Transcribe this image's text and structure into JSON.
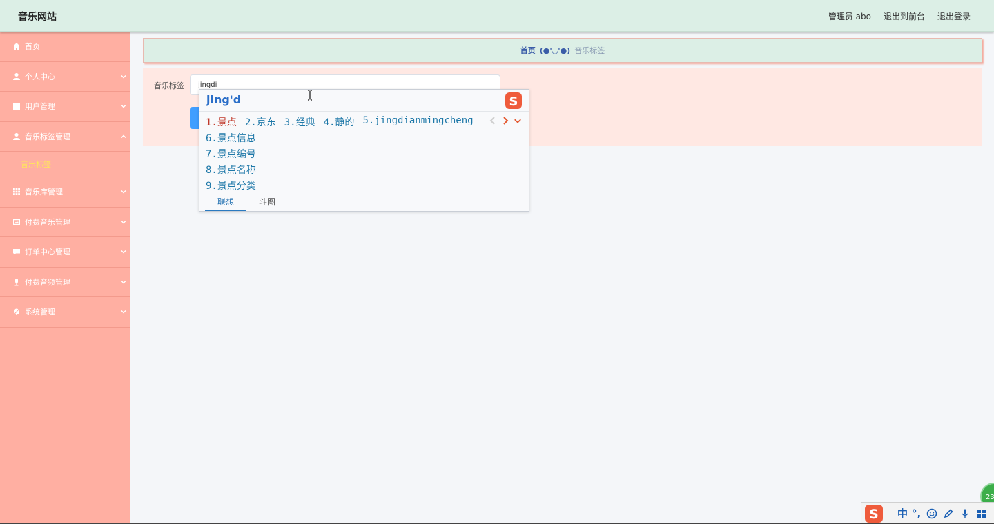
{
  "header": {
    "site_title": "音乐网站",
    "admin_label": "管理员 abo",
    "to_frontend": "退出到前台",
    "logout": "退出登录"
  },
  "sidebar": {
    "items": [
      {
        "label": "首页",
        "icon": "home-icon",
        "chevron": false
      },
      {
        "label": "个人中心",
        "icon": "user-icon",
        "chevron": true
      },
      {
        "label": "用户管理",
        "icon": "chart-icon",
        "chevron": true
      },
      {
        "label": "音乐标签管理",
        "icon": "user-icon",
        "chevron": "up"
      },
      {
        "label": "音乐库管理",
        "icon": "grid-icon",
        "chevron": true
      },
      {
        "label": "付费音乐管理",
        "icon": "image-icon",
        "chevron": true
      },
      {
        "label": "订单中心管理",
        "icon": "comment-icon",
        "chevron": true
      },
      {
        "label": "付费音频管理",
        "icon": "microphone-icon",
        "chevron": true
      },
      {
        "label": "系统管理",
        "icon": "bell-slash-icon",
        "chevron": true
      }
    ],
    "active_sub": "音乐标签"
  },
  "breadcrumb": {
    "home": "首页",
    "face": "(●'◡'●)",
    "current": "音乐标签"
  },
  "search": {
    "label": "音乐标签",
    "value": "jingdi"
  },
  "ime": {
    "composition": "jing'd",
    "row1": [
      {
        "text": "1.景点",
        "selected": true
      },
      {
        "text": "2.京东",
        "selected": false
      },
      {
        "text": "3.经典",
        "selected": false
      },
      {
        "text": "4.静的",
        "selected": false
      },
      {
        "text": "5.jingdianmingcheng",
        "selected": false
      }
    ],
    "more": [
      "6.景点信息",
      "7.景点编号",
      "8.景点名称",
      "9.景点分类"
    ],
    "tabs": [
      "联想",
      "斗图"
    ],
    "logo_letter": "S"
  },
  "tray": {
    "lang": "中",
    "punct": "°,",
    "badge": "23"
  },
  "colors": {
    "sidebar": "#ffafa2",
    "header": "#dcefe6",
    "accent_yellow": "#ffe55c",
    "primary": "#409eff"
  }
}
